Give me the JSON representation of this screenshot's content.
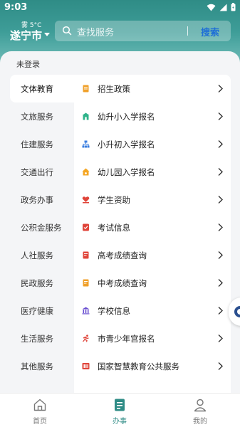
{
  "status_bar": {
    "time": "9:03"
  },
  "header": {
    "weather": "雾 5°C",
    "city": "遂宁市",
    "search_placeholder": "查找服务",
    "search_button": "搜索"
  },
  "login_status": "未登录",
  "categories": [
    {
      "label": "文体教育",
      "active": true
    },
    {
      "label": "文旅服务"
    },
    {
      "label": "住建服务"
    },
    {
      "label": "交通出行"
    },
    {
      "label": "政务办事"
    },
    {
      "label": "公积金服务"
    },
    {
      "label": "人社服务"
    },
    {
      "label": "民政服务"
    },
    {
      "label": "医疗健康"
    },
    {
      "label": "生活服务"
    },
    {
      "label": "其他服务"
    }
  ],
  "services": [
    {
      "label": "招生政策",
      "icon": "document-icon",
      "color": "#f0a02a"
    },
    {
      "label": "幼升小入学报名",
      "icon": "school-icon",
      "color": "#2fb38a"
    },
    {
      "label": "小升初入学报名",
      "icon": "org-chart-icon",
      "color": "#3b7fe0"
    },
    {
      "label": "幼儿园入学报名",
      "icon": "kindergarten-icon",
      "color": "#f5a623"
    },
    {
      "label": "学生资助",
      "icon": "heart-hand-icon",
      "color": "#e0453a"
    },
    {
      "label": "考试信息",
      "icon": "exam-icon",
      "color": "#e0453a"
    },
    {
      "label": "高考成绩查询",
      "icon": "score-icon",
      "color": "#e0453a"
    },
    {
      "label": "中考成绩查询",
      "icon": "score-icon",
      "color": "#f0a02a"
    },
    {
      "label": "学校信息",
      "icon": "building-icon",
      "color": "#6a4fd1"
    },
    {
      "label": "市青少年宫报名",
      "icon": "runner-icon",
      "color": "#e0453a"
    },
    {
      "label": "国家智慧教育公共服务",
      "icon": "badge-icon",
      "color": "#e0453a"
    }
  ],
  "bottom_nav": [
    {
      "label": "首页",
      "icon": "home-icon"
    },
    {
      "label": "办事",
      "icon": "services-icon",
      "active": true
    },
    {
      "label": "我的",
      "icon": "profile-icon"
    }
  ],
  "colors": {
    "brand": "#2f8c86",
    "search_button": "#1f6fd6"
  }
}
